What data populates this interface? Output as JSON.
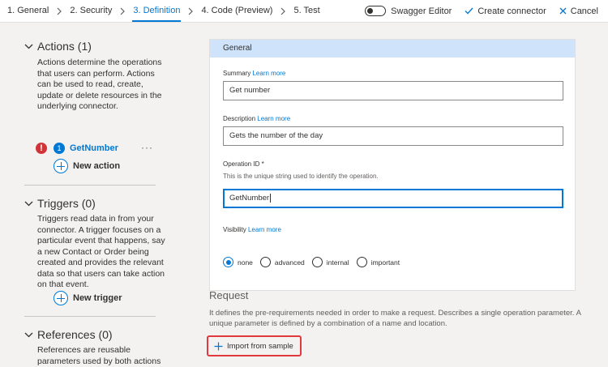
{
  "steps": [
    {
      "label": "1. General"
    },
    {
      "label": "2. Security"
    },
    {
      "label": "3. Definition"
    },
    {
      "label": "4. Code (Preview)"
    },
    {
      "label": "5. Test"
    }
  ],
  "active_step": "3. Definition",
  "toolbar": {
    "swagger_label": "Swagger Editor",
    "create_label": "Create connector",
    "cancel_label": "Cancel"
  },
  "left_panel": {
    "actions": {
      "title": "Actions (1)",
      "description": "Actions determine the operations that users can perform. Actions can be used to read, create, update or delete resources in the underlying connector.",
      "items": [
        {
          "badge": "1",
          "name": "GetNumber",
          "error": "!",
          "menu": "···"
        }
      ],
      "add_label": "New action"
    },
    "triggers": {
      "title": "Triggers (0)",
      "description": "Triggers read data in from your connector. A trigger focuses on a particular event that happens, say a new Contact or Order being created and provides the relevant data so that users can take action on that event.",
      "add_label": "New trigger"
    },
    "references": {
      "title": "References (0)",
      "description": "References are reusable parameters used by both actions and triggers."
    }
  },
  "general": {
    "header": "General",
    "summary": {
      "label": "Summary",
      "link": "Learn more",
      "value": "Get number"
    },
    "description": {
      "label": "Description",
      "link": "Learn more",
      "value": "Gets the number of the day"
    },
    "operation_id": {
      "label": "Operation ID *",
      "help": "This is the unique string used to identify the operation.",
      "value": "GetNumber"
    },
    "visibility": {
      "label": "Visibility",
      "link": "Learn more",
      "options": [
        "none",
        "advanced",
        "internal",
        "important"
      ],
      "selected": "none"
    }
  },
  "request": {
    "title": "Request",
    "description": "It defines the pre-requirements needed in order to make a request. Describes a single operation parameter. A unique parameter is defined by a combination of a name and location.",
    "import_label": "Import from sample"
  },
  "colors": {
    "accent": "#0078d4",
    "error": "#d13438",
    "highlight_border": "#e0393e",
    "panel_bg": "#f3f2f1",
    "section_header_bg": "#cfe4fa"
  }
}
